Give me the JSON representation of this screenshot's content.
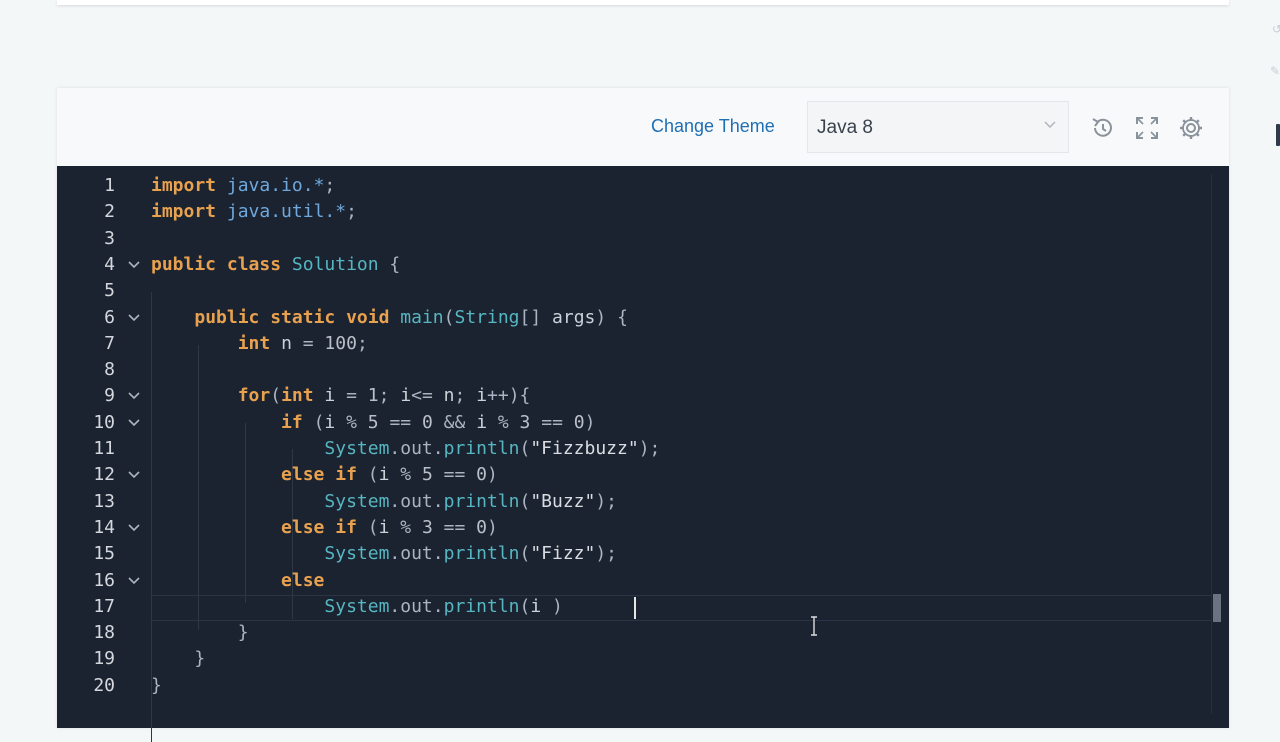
{
  "toolbar": {
    "change_theme_label": "Change Theme",
    "language_selected": "Java 8",
    "icons": [
      "reset-history-icon",
      "fullscreen-icon",
      "settings-icon"
    ]
  },
  "editor": {
    "active_line": 17,
    "lines": [
      {
        "n": "1",
        "tokens": [
          [
            "kw",
            "import"
          ],
          [
            "txt",
            " "
          ],
          [
            "pkg",
            "java.io.*"
          ],
          [
            "txt",
            ";"
          ]
        ]
      },
      {
        "n": "2",
        "tokens": [
          [
            "kw",
            "import"
          ],
          [
            "txt",
            " "
          ],
          [
            "pkg",
            "java.util.*"
          ],
          [
            "txt",
            ";"
          ]
        ]
      },
      {
        "n": "3",
        "tokens": []
      },
      {
        "n": "4",
        "fold": true,
        "tokens": [
          [
            "kw",
            "public class"
          ],
          [
            "txt",
            " "
          ],
          [
            "ty",
            "Solution"
          ],
          [
            "txt",
            " {"
          ]
        ]
      },
      {
        "n": "5",
        "tokens": []
      },
      {
        "n": "6",
        "fold": true,
        "tokens": [
          [
            "txt",
            "    "
          ],
          [
            "kw",
            "public static void"
          ],
          [
            "txt",
            " "
          ],
          [
            "ty",
            "main"
          ],
          [
            "txt",
            "("
          ],
          [
            "ty",
            "String"
          ],
          [
            "txt",
            "[] "
          ],
          [
            "nm",
            "args"
          ],
          [
            "txt",
            ") {"
          ]
        ]
      },
      {
        "n": "7",
        "tokens": [
          [
            "txt",
            "        "
          ],
          [
            "kw",
            "int"
          ],
          [
            "txt",
            " "
          ],
          [
            "nm",
            "n"
          ],
          [
            "txt",
            " = "
          ],
          [
            "num",
            "100"
          ],
          [
            "txt",
            ";"
          ]
        ]
      },
      {
        "n": "8",
        "tokens": []
      },
      {
        "n": "9",
        "fold": true,
        "tokens": [
          [
            "txt",
            "        "
          ],
          [
            "kw",
            "for"
          ],
          [
            "txt",
            "("
          ],
          [
            "kw",
            "int"
          ],
          [
            "txt",
            " "
          ],
          [
            "nm",
            "i"
          ],
          [
            "txt",
            " = "
          ],
          [
            "num",
            "1"
          ],
          [
            "txt",
            "; "
          ],
          [
            "nm",
            "i"
          ],
          [
            "txt",
            "<= "
          ],
          [
            "nm",
            "n"
          ],
          [
            "txt",
            "; "
          ],
          [
            "nm",
            "i"
          ],
          [
            "txt",
            "++){"
          ]
        ]
      },
      {
        "n": "10",
        "fold": true,
        "tokens": [
          [
            "txt",
            "            "
          ],
          [
            "kw",
            "if"
          ],
          [
            "txt",
            " ("
          ],
          [
            "nm",
            "i"
          ],
          [
            "txt",
            " % "
          ],
          [
            "num",
            "5"
          ],
          [
            "txt",
            " == "
          ],
          [
            "num",
            "0"
          ],
          [
            "txt",
            " && "
          ],
          [
            "nm",
            "i"
          ],
          [
            "txt",
            " % "
          ],
          [
            "num",
            "3"
          ],
          [
            "txt",
            " == "
          ],
          [
            "num",
            "0"
          ],
          [
            "txt",
            ")"
          ]
        ]
      },
      {
        "n": "11",
        "tokens": [
          [
            "txt",
            "                "
          ],
          [
            "ty",
            "System"
          ],
          [
            "txt",
            ".out."
          ],
          [
            "ty",
            "println"
          ],
          [
            "txt",
            "("
          ],
          [
            "str",
            "\"Fizzbuzz\""
          ],
          [
            "txt",
            ");"
          ]
        ]
      },
      {
        "n": "12",
        "fold": true,
        "tokens": [
          [
            "txt",
            "            "
          ],
          [
            "kw",
            "else if"
          ],
          [
            "txt",
            " ("
          ],
          [
            "nm",
            "i"
          ],
          [
            "txt",
            " % "
          ],
          [
            "num",
            "5"
          ],
          [
            "txt",
            " == "
          ],
          [
            "num",
            "0"
          ],
          [
            "txt",
            ")"
          ]
        ]
      },
      {
        "n": "13",
        "tokens": [
          [
            "txt",
            "                "
          ],
          [
            "ty",
            "System"
          ],
          [
            "txt",
            ".out."
          ],
          [
            "ty",
            "println"
          ],
          [
            "txt",
            "("
          ],
          [
            "str",
            "\"Buzz\""
          ],
          [
            "txt",
            ");"
          ]
        ]
      },
      {
        "n": "14",
        "fold": true,
        "tokens": [
          [
            "txt",
            "            "
          ],
          [
            "kw",
            "else if"
          ],
          [
            "txt",
            " ("
          ],
          [
            "nm",
            "i"
          ],
          [
            "txt",
            " % "
          ],
          [
            "num",
            "3"
          ],
          [
            "txt",
            " == "
          ],
          [
            "num",
            "0"
          ],
          [
            "txt",
            ")"
          ]
        ]
      },
      {
        "n": "15",
        "tokens": [
          [
            "txt",
            "                "
          ],
          [
            "ty",
            "System"
          ],
          [
            "txt",
            ".out."
          ],
          [
            "ty",
            "println"
          ],
          [
            "txt",
            "("
          ],
          [
            "str",
            "\"Fizz\""
          ],
          [
            "txt",
            ");"
          ]
        ]
      },
      {
        "n": "16",
        "fold": true,
        "tokens": [
          [
            "txt",
            "            "
          ],
          [
            "kw",
            "else"
          ]
        ]
      },
      {
        "n": "17",
        "tokens": [
          [
            "txt",
            "                "
          ],
          [
            "ty",
            "System"
          ],
          [
            "txt",
            ".out."
          ],
          [
            "ty",
            "println"
          ],
          [
            "txt",
            "("
          ],
          [
            "nm",
            "i"
          ],
          [
            "txt",
            " )"
          ]
        ]
      },
      {
        "n": "18",
        "tokens": [
          [
            "txt",
            "        }"
          ]
        ]
      },
      {
        "n": "19",
        "tokens": [
          [
            "txt",
            "    }"
          ]
        ]
      },
      {
        "n": "20",
        "tokens": [
          [
            "txt",
            "}"
          ]
        ]
      }
    ]
  },
  "colors": {
    "editor_background": "#1b2330",
    "keyword": "#e8a14f",
    "link": "#1f6fb5"
  }
}
